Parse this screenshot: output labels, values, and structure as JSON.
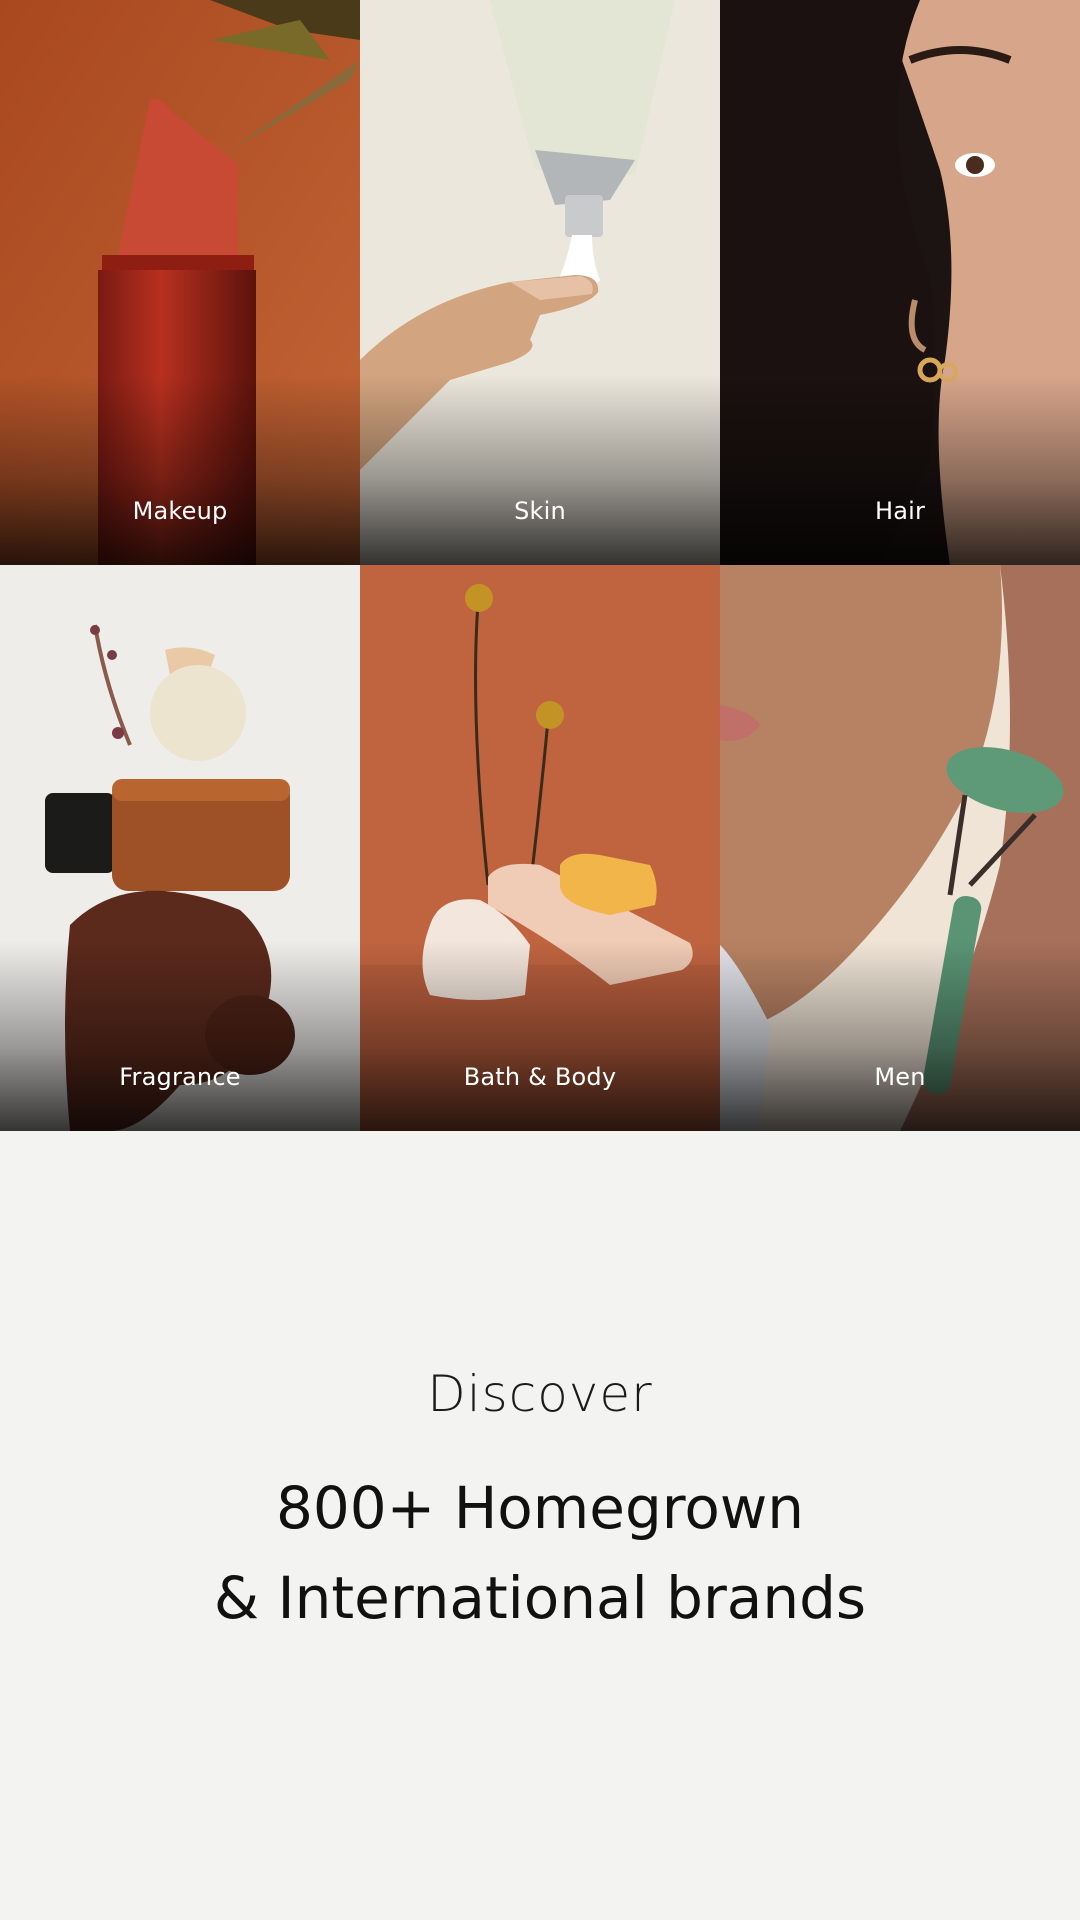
{
  "categories": [
    {
      "label": "Makeup",
      "image": "lipstick-photo"
    },
    {
      "label": "Skin",
      "image": "cream-tube-photo"
    },
    {
      "label": "Hair",
      "image": "woman-face-photo"
    },
    {
      "label": "Fragrance",
      "image": "perfume-bottle-photo"
    },
    {
      "label": "Bath & Body",
      "image": "soap-bar-photo"
    },
    {
      "label": "Men",
      "image": "face-roller-photo"
    }
  ],
  "discover": {
    "eyebrow": "Discover",
    "line1": "800+ Homegrown",
    "line2": "& International brands"
  },
  "colors": {
    "page_background": "#f3f3f1",
    "makeup_background": "#b5532a",
    "bath_background": "#c06440",
    "label_text": "#ffffff",
    "heading_text": "#111111"
  }
}
